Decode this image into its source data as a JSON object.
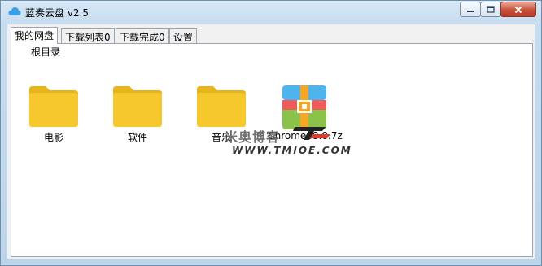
{
  "window": {
    "title": "蓝奏云盘 v2.5"
  },
  "tabs": [
    {
      "label": "我的网盘",
      "active": true
    },
    {
      "label": "下载列表0",
      "active": false
    },
    {
      "label": "下载完成0",
      "active": false
    },
    {
      "label": "设置",
      "active": false
    }
  ],
  "breadcrumb": "根目录",
  "items": [
    {
      "name": "电影",
      "type": "folder",
      "icon": "folder-icon"
    },
    {
      "name": "软件",
      "type": "folder",
      "icon": "folder-icon"
    },
    {
      "name": "音乐",
      "type": "folder",
      "icon": "folder-icon"
    },
    {
      "name": "Chrome88.0.7z",
      "type": "file",
      "icon": "archive-icon"
    }
  ],
  "watermark": {
    "text_cn": "米奥博客",
    "url": "WWW.TMIOE.COM"
  },
  "colors": {
    "folder": "#f6c82e",
    "folder_tab": "#e7b420",
    "close_button": "#c8503a",
    "accent": "#3aa0e8"
  }
}
